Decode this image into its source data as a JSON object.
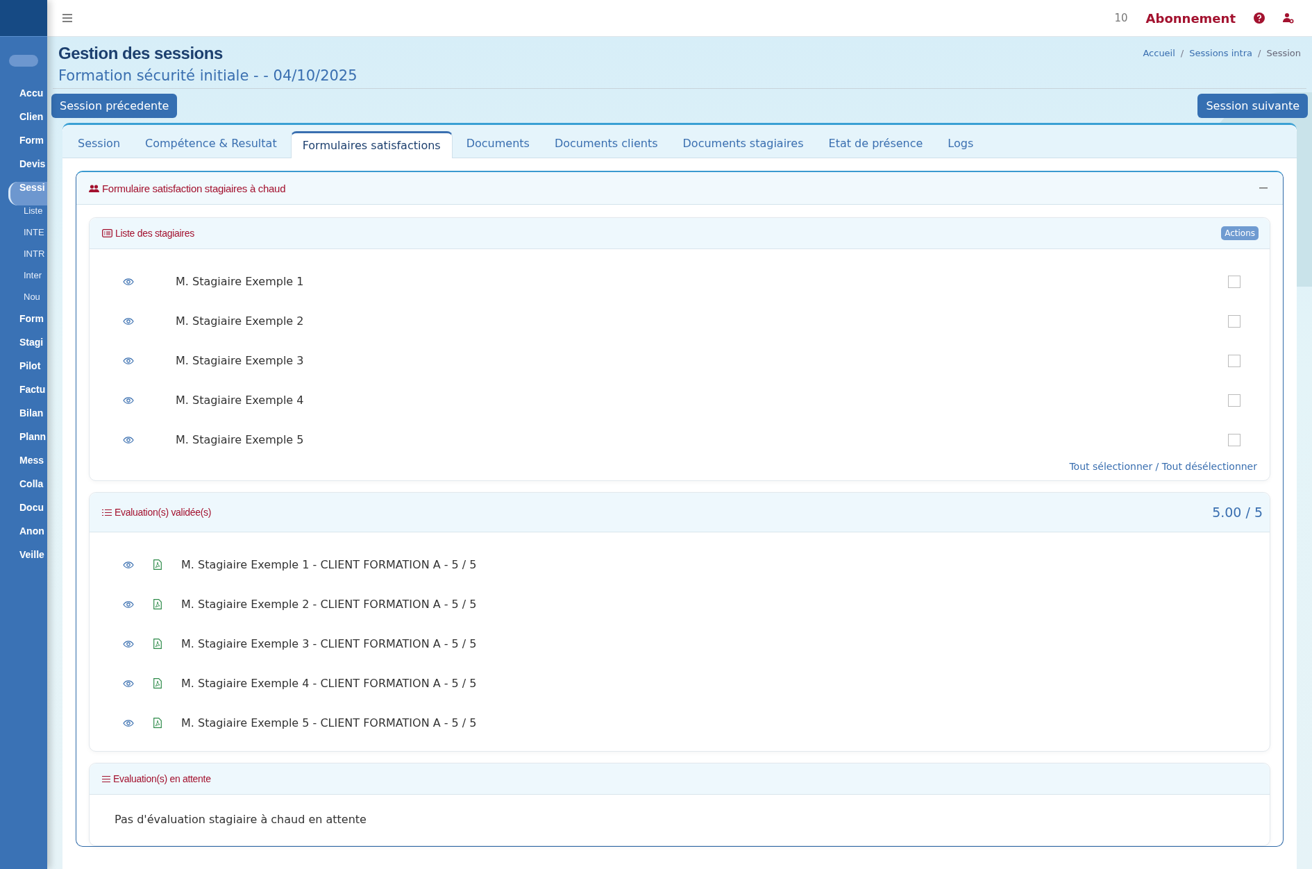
{
  "sidebar": {
    "toggle": {
      "on": false
    },
    "items": [
      {
        "label": "Accu",
        "selected": false
      },
      {
        "label": "Clien",
        "selected": false
      },
      {
        "label": "Form",
        "selected": false
      },
      {
        "label": "Devis",
        "selected": false
      },
      {
        "label": "Sessi",
        "selected": true,
        "children": [
          {
            "label": "Liste"
          },
          {
            "label": "INTE"
          },
          {
            "label": "INTR"
          },
          {
            "label": "Inter"
          },
          {
            "label": "Nou"
          }
        ]
      },
      {
        "label": "Form",
        "selected": false
      },
      {
        "label": "Stagi",
        "selected": false
      },
      {
        "label": "Pilot",
        "selected": false
      },
      {
        "label": "Factu",
        "selected": false
      },
      {
        "label": "Bilan",
        "selected": false
      },
      {
        "label": "Plann",
        "selected": false
      },
      {
        "label": "Mess",
        "selected": false
      },
      {
        "label": "Colla",
        "selected": false
      },
      {
        "label": "Docu",
        "selected": false
      },
      {
        "label": "Anon",
        "selected": false
      },
      {
        "label": "Veille",
        "selected": false
      }
    ]
  },
  "topbar": {
    "count": "10",
    "subscription": "Abonnement"
  },
  "page": {
    "title": "Gestion des sessions",
    "subtitle": "Formation sécurité initiale - - 04/10/2025",
    "breadcrumb": {
      "items": [
        "Accueil",
        "Sessions intra",
        "Session"
      ],
      "separator": "/"
    },
    "prev_button": "Session précedente",
    "next_button": "Session suivante"
  },
  "tabs": [
    {
      "label": "Session",
      "selected": false
    },
    {
      "label": "Compétence & Resultat",
      "selected": false
    },
    {
      "label": "Formulaires satisfactions",
      "selected": true
    },
    {
      "label": "Documents",
      "selected": false
    },
    {
      "label": "Documents clients",
      "selected": false
    },
    {
      "label": "Documents stagiaires",
      "selected": false
    },
    {
      "label": "Etat de présence",
      "selected": false
    },
    {
      "label": "Logs",
      "selected": false
    }
  ],
  "panel": {
    "title": "Formulaire satisfaction stagiaires à chaud",
    "trainees": {
      "title": "Liste des stagiaires",
      "actions": "Actions",
      "rows": [
        {
          "name": "M. Stagiaire Exemple 1",
          "checked": false
        },
        {
          "name": "M. Stagiaire Exemple 2",
          "checked": false
        },
        {
          "name": "M. Stagiaire Exemple 3",
          "checked": false
        },
        {
          "name": "M. Stagiaire Exemple 4",
          "checked": false
        },
        {
          "name": "M. Stagiaire Exemple 5",
          "checked": false
        }
      ],
      "select_all": "Tout sélectionner / Tout désélectionner"
    },
    "validated": {
      "title": "Evaluation(s) validée(s)",
      "score": "5.00 / 5",
      "rows": [
        "M. Stagiaire Exemple 1 - CLIENT FORMATION A - 5 / 5",
        "M. Stagiaire Exemple 2 - CLIENT FORMATION A - 5 / 5",
        "M. Stagiaire Exemple 3 - CLIENT FORMATION A - 5 / 5",
        "M. Stagiaire Exemple 4 - CLIENT FORMATION A - 5 / 5",
        "M. Stagiaire Exemple 5 - CLIENT FORMATION A - 5 / 5"
      ]
    },
    "pending": {
      "title": "Evaluation(s) en attente",
      "message": "Pas d'évaluation stagiaire à chaud en attente"
    }
  }
}
